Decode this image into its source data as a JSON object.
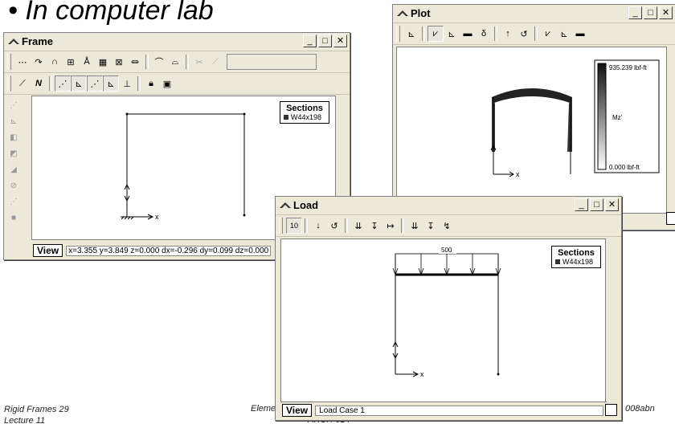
{
  "slide": {
    "bullet": "• In computer lab",
    "footer_left_line1": "Rigid Frames 29",
    "footer_left_line2": "Lecture 11",
    "footer_mid": "Eleme",
    "footer_mid2": "ARCH 614",
    "footer_right": "008abn"
  },
  "frame_window": {
    "title": "Frame",
    "legend_title": "Sections",
    "legend_item": "W44x198",
    "status_tab": "View",
    "status_text": "x=3.355 y=3.849 z=0.000 dx=-0.296 dy=0.099 dz=0.000",
    "axis_label": "x"
  },
  "plot_window": {
    "title": "Plot",
    "scale_max": "935.239 lbf-ft",
    "scale_mid": "Mz'",
    "scale_min": "0.000 lbf-ft",
    "axis_label": "x",
    "tools": [
      "Mz-toggle",
      "Mz",
      "Vy",
      "Px",
      "deflection",
      "up",
      "rotate",
      "My",
      "Vz",
      "Tx"
    ]
  },
  "load_window": {
    "title": "Load",
    "load_value": "500",
    "legend_title": "Sections",
    "legend_item": "W44x198",
    "status_tab": "View",
    "status_text": "Load Case 1",
    "axis_label": "x",
    "case_button": "10"
  },
  "colors": {
    "window_bg": "#ece9d8",
    "frame_line": "#000000"
  }
}
